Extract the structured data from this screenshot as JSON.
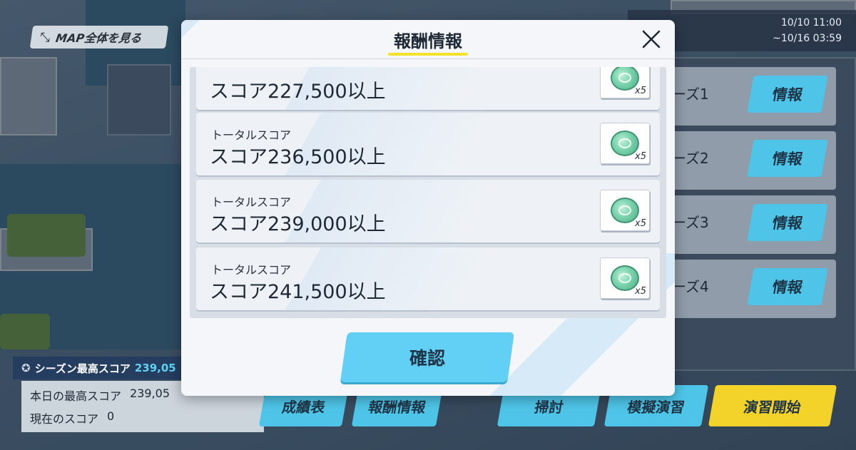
{
  "map_button": {
    "label": "MAP全体を見る"
  },
  "date_range": {
    "start": "10/10 11:00",
    "end": "~10/16 03:59"
  },
  "stages": [
    {
      "name": "ーズ1",
      "info_label": "情報"
    },
    {
      "name": "ーズ2",
      "info_label": "情報"
    },
    {
      "name": "ーズ3",
      "info_label": "情報"
    },
    {
      "name": "ーズ4",
      "info_label": "情報"
    }
  ],
  "season": {
    "label": "シーズン最高スコア",
    "value": "239,05"
  },
  "scores": {
    "today_label": "本日の最高スコア",
    "today_value": "239,05",
    "current_label": "現在のスコア",
    "current_value": "0"
  },
  "bottom_buttons": {
    "results": "成績表",
    "rewards": "報酬情報",
    "sweep": "掃討",
    "mock": "模擬演習",
    "start": "演習開始"
  },
  "modal": {
    "title": "報酬情報",
    "confirm_label": "確認",
    "rewards": [
      {
        "sub": "",
        "main": "スコア227,500以上",
        "qty": "x5"
      },
      {
        "sub": "トータルスコア",
        "main": "スコア236,500以上",
        "qty": "x5"
      },
      {
        "sub": "トータルスコア",
        "main": "スコア239,000以上",
        "qty": "x5"
      },
      {
        "sub": "トータルスコア",
        "main": "スコア241,500以上",
        "qty": "x5"
      }
    ]
  },
  "colors": {
    "accent_blue": "#62cff5",
    "accent_yellow": "#f3d22a",
    "season_value": "#5fd1f4"
  }
}
